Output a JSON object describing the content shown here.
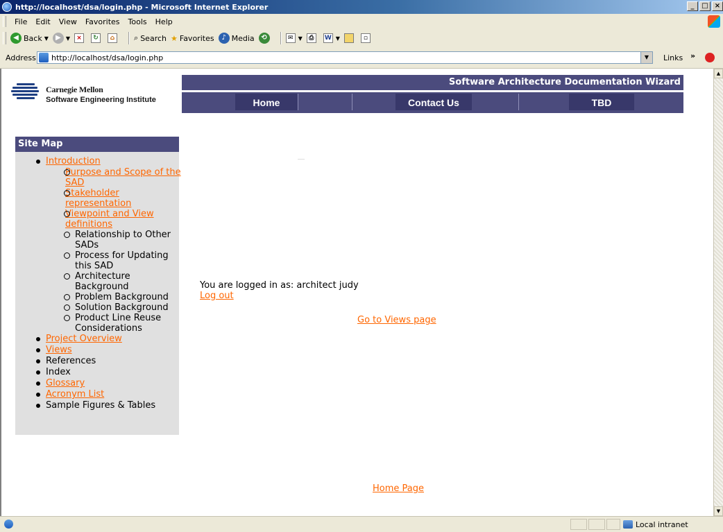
{
  "window": {
    "title": "http://localhost/dsa/login.php - Microsoft Internet Explorer",
    "controls": [
      "_",
      "□",
      "×"
    ]
  },
  "menu": [
    "File",
    "Edit",
    "View",
    "Favorites",
    "Tools",
    "Help"
  ],
  "toolbar": {
    "back": "Back",
    "search": "Search",
    "favorites": "Favorites",
    "media": "Media"
  },
  "address": {
    "label": "Address",
    "url": "http://localhost/dsa/login.php",
    "links": "Links",
    "chevron": "»"
  },
  "header": {
    "org_line1": "Carnegie Mellon",
    "org_line2": "Software Engineering Institute",
    "banner": "Software Architecture Documentation Wizard"
  },
  "nav": [
    "Home",
    "Contact Us",
    "TBD"
  ],
  "sitemap": {
    "title": "Site Map",
    "introduction": "Introduction",
    "intro_items": [
      {
        "label": "Purpose and Scope of the SAD",
        "link": true
      },
      {
        "label": "Stakeholder representation",
        "link": true
      },
      {
        "label": "Viewpoint and View definitions",
        "link": true
      },
      {
        "label": "Relationship to Other SADs",
        "link": false
      },
      {
        "label": "Process for Updating this SAD",
        "link": false
      },
      {
        "label": "Architecture Background",
        "link": false
      },
      {
        "label": "Problem Background",
        "link": false
      },
      {
        "label": "Solution Background",
        "link": false
      },
      {
        "label": "Product Line Reuse Considerations",
        "link": false
      }
    ],
    "top_items": [
      {
        "label": "Project Overview",
        "link": true
      },
      {
        "label": "Views",
        "link": true
      },
      {
        "label": "References",
        "link": false
      },
      {
        "label": "Index",
        "link": false
      },
      {
        "label": "Glossary",
        "link": true
      },
      {
        "label": "Acronym List",
        "link": true
      },
      {
        "label": "Sample Figures & Tables",
        "link": false
      }
    ]
  },
  "main": {
    "logged_in": "You are logged in as: architect judy",
    "logout": "Log out",
    "go_views": "Go to Views page",
    "home_page": "Home Page"
  },
  "status": {
    "zone": "Local intranet"
  }
}
